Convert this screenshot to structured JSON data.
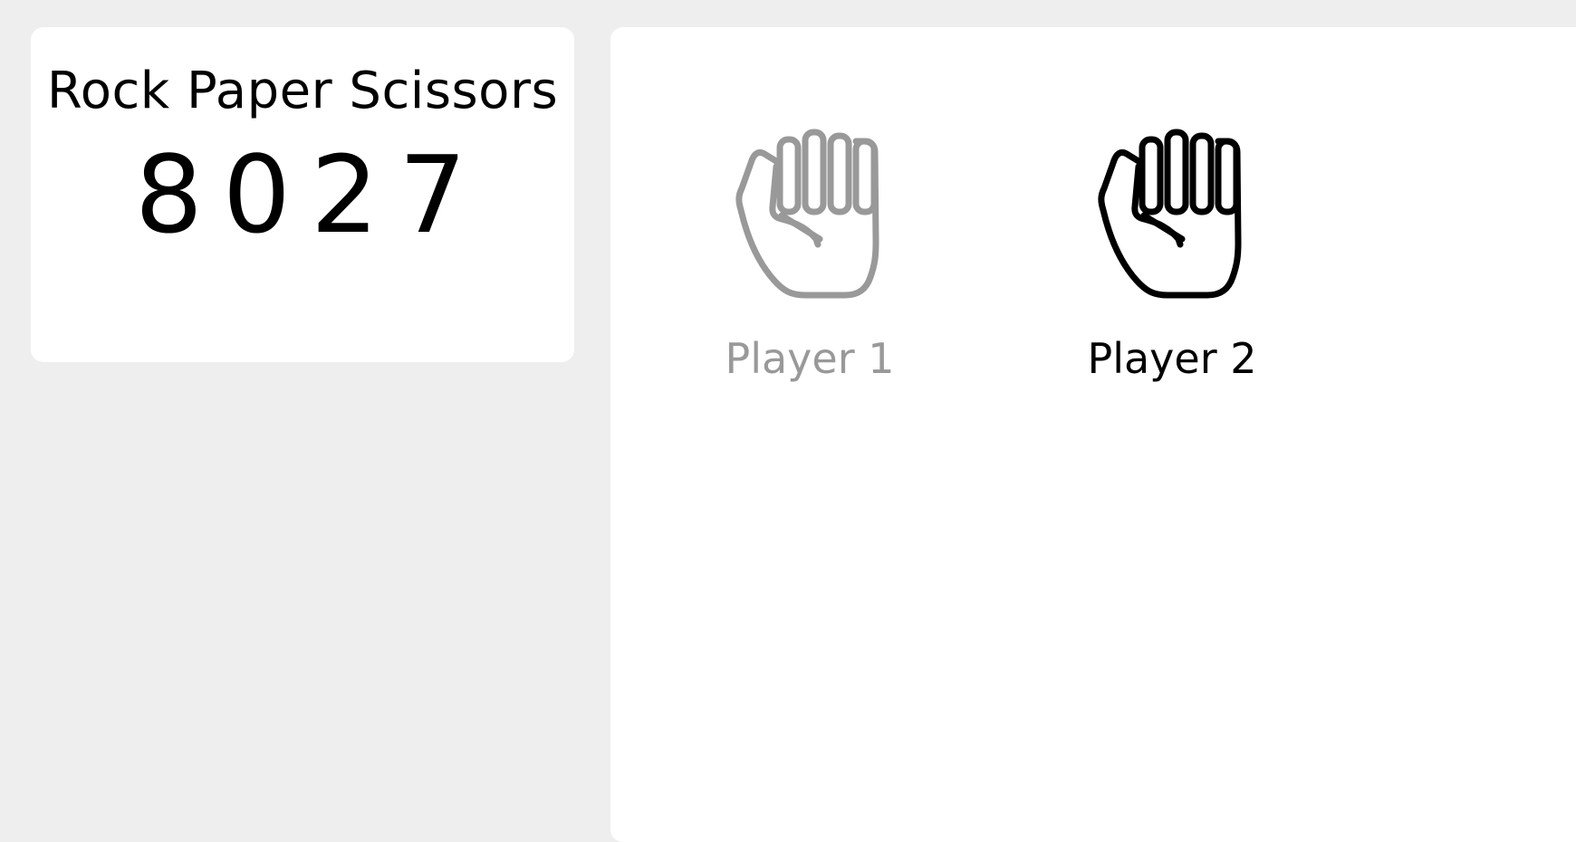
{
  "title": "Rock Paper Scissors",
  "score": "8027",
  "players": [
    {
      "label": "Player 1",
      "choice_icon": "rock-fist-icon",
      "color": "#999999",
      "active": false
    },
    {
      "label": "Player 2",
      "choice_icon": "rock-fist-icon",
      "color": "#000000",
      "active": true
    }
  ],
  "colors": {
    "background": "#eeeeee",
    "panel": "#ffffff",
    "inactive": "#999999",
    "active": "#000000"
  }
}
